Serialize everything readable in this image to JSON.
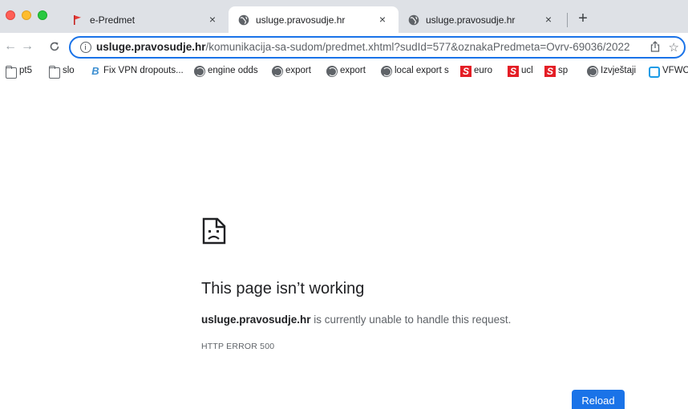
{
  "tabs": [
    {
      "title": "e-Predmet",
      "close": "×",
      "icon": "red-flag-icon"
    },
    {
      "title": "usluge.pravosudje.hr",
      "close": "×",
      "icon": "globe-icon",
      "active": true
    },
    {
      "title": "usluge.pravosudje.hr",
      "close": "×",
      "icon": "globe-icon"
    }
  ],
  "new_tab_label": "+",
  "toolbar": {
    "back": "←",
    "forward": "→",
    "reload": "C",
    "url_host": "usluge.pravosudje.hr",
    "url_path": "/komunikacija-sa-sudom/predmet.xhtml?sudId=577&oznakaPredmeta=Ovrv-69036/2022",
    "share": "⇪",
    "star": "☆"
  },
  "bookmarks": [
    {
      "label": "pt5",
      "icon": "folder-icon"
    },
    {
      "label": "slo",
      "icon": "folder-icon"
    },
    {
      "label": "Fix VPN dropouts...",
      "icon": "b-icon"
    },
    {
      "label": "engine odds",
      "icon": "globe-icon"
    },
    {
      "label": "export",
      "icon": "globe-icon"
    },
    {
      "label": "export",
      "icon": "globe-icon"
    },
    {
      "label": "local export s",
      "icon": "globe-icon"
    },
    {
      "label": "euro",
      "icon": "s-badge-icon"
    },
    {
      "label": "ucl",
      "icon": "s-badge-icon"
    },
    {
      "label": "sp",
      "icon": "s-badge-icon"
    },
    {
      "label": "Izvještaji",
      "icon": "globe-icon"
    },
    {
      "label": "VFWC",
      "icon": "vfw-icon"
    }
  ],
  "error": {
    "title": "This page isn’t working",
    "host": "usluge.pravosudje.hr",
    "message": " is currently unable to handle this request.",
    "code": "HTTP ERROR 500",
    "reload_label": "Reload"
  },
  "colors": {
    "accent": "#1a73e8",
    "tabstrip_bg": "#dee1e6",
    "close_light": "#ff5f57",
    "minimize_light": "#febc2e",
    "maximize_light": "#28c840",
    "s_badge": "#e41e26"
  }
}
